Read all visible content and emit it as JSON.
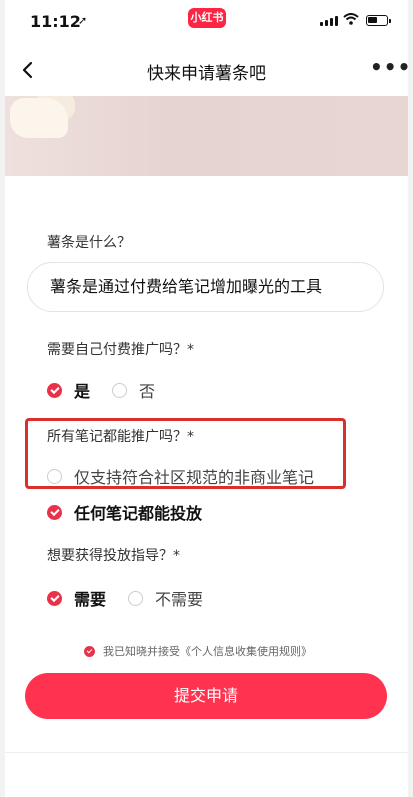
{
  "status": {
    "time": "11:12",
    "brand": "小红书"
  },
  "nav": {
    "title": "快来申请薯条吧"
  },
  "form": {
    "q1": {
      "label": "薯条是什么？",
      "answer": "薯条是通过付费给笔记增加曝光的工具"
    },
    "q2": {
      "label": "需要自己付费推广吗？*",
      "options": [
        "是",
        "否"
      ],
      "selected": "是"
    },
    "q3": {
      "label": "所有笔记都能推广吗？*",
      "options": [
        "仅支持符合社区规范的非商业笔记",
        "任何笔记都能投放"
      ],
      "selected": "任何笔记都能投放"
    },
    "q4": {
      "label": "想要获得投放指导？*",
      "options": [
        "需要",
        "不需要"
      ],
      "selected": "需要"
    }
  },
  "consent": {
    "text": "我已知晓并接受《个人信息收集使用规则》",
    "checked": true
  },
  "submit": {
    "label": "提交申请"
  },
  "colors": {
    "accent": "#ff3350",
    "highlight": "#d9302c"
  }
}
